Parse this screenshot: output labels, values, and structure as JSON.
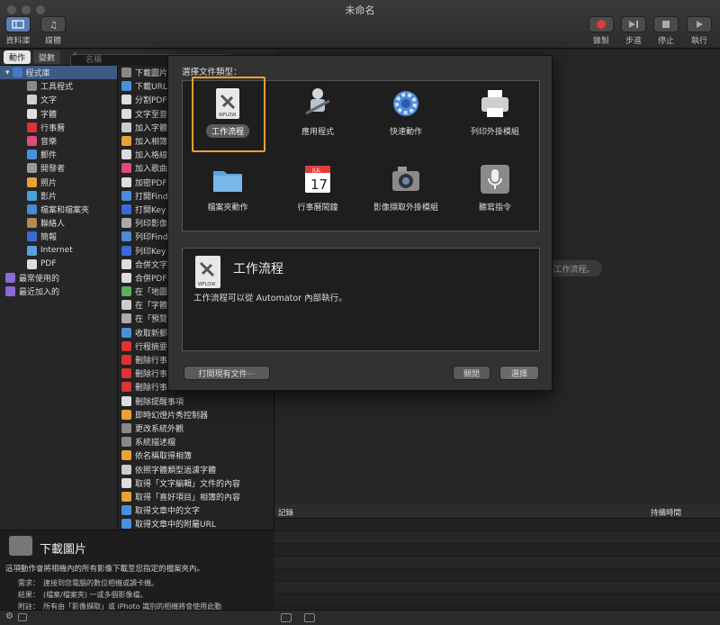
{
  "window": {
    "title": "未命名"
  },
  "toolbar": {
    "left": [
      {
        "label": "資料庫",
        "icon": "library-icon"
      },
      {
        "label": "媒體",
        "icon": "media-icon"
      }
    ],
    "right": [
      {
        "label": "錄製",
        "icon": "record-icon"
      },
      {
        "label": "步進",
        "icon": "step-icon"
      },
      {
        "label": "停止",
        "icon": "stop-icon"
      },
      {
        "label": "執行",
        "icon": "run-icon"
      }
    ]
  },
  "search": {
    "tabs": [
      "動作",
      "變數"
    ],
    "placeholder": "名稱"
  },
  "library": [
    {
      "label": "程式庫",
      "indent": 0,
      "color": "#4a77c4",
      "selected": true
    },
    {
      "label": "工具程式",
      "indent": 1,
      "color": "#8a8a8a"
    },
    {
      "label": "文字",
      "indent": 1,
      "color": "#d0d0d0"
    },
    {
      "label": "字體",
      "indent": 1,
      "color": "#e0e0e0"
    },
    {
      "label": "行事曆",
      "indent": 1,
      "color": "#d33"
    },
    {
      "label": "音樂",
      "indent": 1,
      "color": "#e24a7a"
    },
    {
      "label": "郵件",
      "indent": 1,
      "color": "#4a90d9"
    },
    {
      "label": "開發者",
      "indent": 1,
      "color": "#999"
    },
    {
      "label": "照片",
      "indent": 1,
      "color": "#e8a23a"
    },
    {
      "label": "影片",
      "indent": 1,
      "color": "#4aa0d9"
    },
    {
      "label": "檔案和檔案夾",
      "indent": 1,
      "color": "#4a8ad9"
    },
    {
      "label": "聯絡人",
      "indent": 1,
      "color": "#b08a5a"
    },
    {
      "label": "簡報",
      "indent": 1,
      "color": "#3a6ad9"
    },
    {
      "label": "Internet",
      "indent": 1,
      "color": "#5aa0e0"
    },
    {
      "label": "PDF",
      "indent": 1,
      "color": "#ddd"
    },
    {
      "label": "最常使用的",
      "indent": 0,
      "color": "#8a6ad9"
    },
    {
      "label": "最近加入的",
      "indent": 0,
      "color": "#8a6ad9"
    }
  ],
  "actions": [
    {
      "label": "下載圖片",
      "color": "#888"
    },
    {
      "label": "下載URL",
      "color": "#4a90d9"
    },
    {
      "label": "分割PDF",
      "color": "#ddd"
    },
    {
      "label": "文字至音",
      "color": "#ddd"
    },
    {
      "label": "加入字體",
      "color": "#ccc"
    },
    {
      "label": "加入相簿",
      "color": "#e8a23a"
    },
    {
      "label": "加入格線",
      "color": "#ddd"
    },
    {
      "label": "加入歌曲",
      "color": "#e24a7a"
    },
    {
      "label": "加密PDF",
      "color": "#ddd"
    },
    {
      "label": "打開Find",
      "color": "#4a8ad9"
    },
    {
      "label": "打開Key",
      "color": "#3a6ad9"
    },
    {
      "label": "列印影像",
      "color": "#aaa"
    },
    {
      "label": "列印Find",
      "color": "#4a8ad9"
    },
    {
      "label": "列印Key",
      "color": "#3a6ad9"
    },
    {
      "label": "合併文字",
      "color": "#ddd"
    },
    {
      "label": "合併PDF",
      "color": "#ddd"
    },
    {
      "label": "在「地圖",
      "color": "#5ab05a"
    },
    {
      "label": "在「字體",
      "color": "#ccc"
    },
    {
      "label": "在「預覽",
      "color": "#aaa"
    },
    {
      "label": "收取新郵",
      "color": "#4a90d9"
    },
    {
      "label": "行程摘要",
      "color": "#d33"
    },
    {
      "label": "刪除行事",
      "color": "#d33"
    },
    {
      "label": "刪除行事",
      "color": "#d33"
    },
    {
      "label": "刪除行事",
      "color": "#d33"
    },
    {
      "label": "刪除提醒事項",
      "color": "#ddd"
    },
    {
      "label": "即時幻燈片秀控制器",
      "color": "#e8a23a"
    },
    {
      "label": "更改系統外觀",
      "color": "#888"
    },
    {
      "label": "系統描述檔",
      "color": "#888"
    },
    {
      "label": "依名稱取得相簿",
      "color": "#e8a23a"
    },
    {
      "label": "依照字體類型過濾字體",
      "color": "#ccc"
    },
    {
      "label": "取得「文字編輯」文件的內容",
      "color": "#ddd"
    },
    {
      "label": "取得「喜好項目」相簿的內容",
      "color": "#e8a23a"
    },
    {
      "label": "取得文章中的文字",
      "color": "#4a90d9"
    },
    {
      "label": "取得文章中的附屬URL",
      "color": "#4a90d9"
    }
  ],
  "description": {
    "title": "下載圖片",
    "text": "這項動作會將相機內的所有影像下載至您指定的檔案夾內。",
    "rows": [
      {
        "key": "需求：",
        "value": "連接到您電腦的數位相機或讀卡機。"
      },
      {
        "key": "結果：",
        "value": "(檔案/檔案夾) 一或多個影像檔。"
      },
      {
        "key": "附註：",
        "value": "所有由「影像擷取」或 iPhoto 識別的相機將會使用此動"
      }
    ]
  },
  "log": {
    "col1": "記錄",
    "col2": "持續時間"
  },
  "workflow_hint": "工作流程。",
  "sheet": {
    "prompt": "選擇文件類型：",
    "types": [
      {
        "label": "工作流程",
        "icon": "workflow-icon",
        "selected": true
      },
      {
        "label": "應用程式",
        "icon": "robot-icon"
      },
      {
        "label": "快速動作",
        "icon": "gear-icon"
      },
      {
        "label": "列印外掛模組",
        "icon": "printer-icon"
      },
      {
        "label": "檔案夾動作",
        "icon": "folder-icon"
      },
      {
        "label": "行事曆鬧鐘",
        "icon": "calendar-icon",
        "calendar": {
          "month": "JUL",
          "day": "17"
        }
      },
      {
        "label": "影像擷取外掛模組",
        "icon": "camera-icon"
      },
      {
        "label": "聽寫指令",
        "icon": "microphone-icon"
      }
    ],
    "icon_caption": "WFLOW",
    "info_title": "工作流程",
    "info_desc": "工作流程可以從 Automator 內部執行。",
    "open_existing": "打開現有文件⋯",
    "close": "關閉",
    "choose": "選擇"
  }
}
